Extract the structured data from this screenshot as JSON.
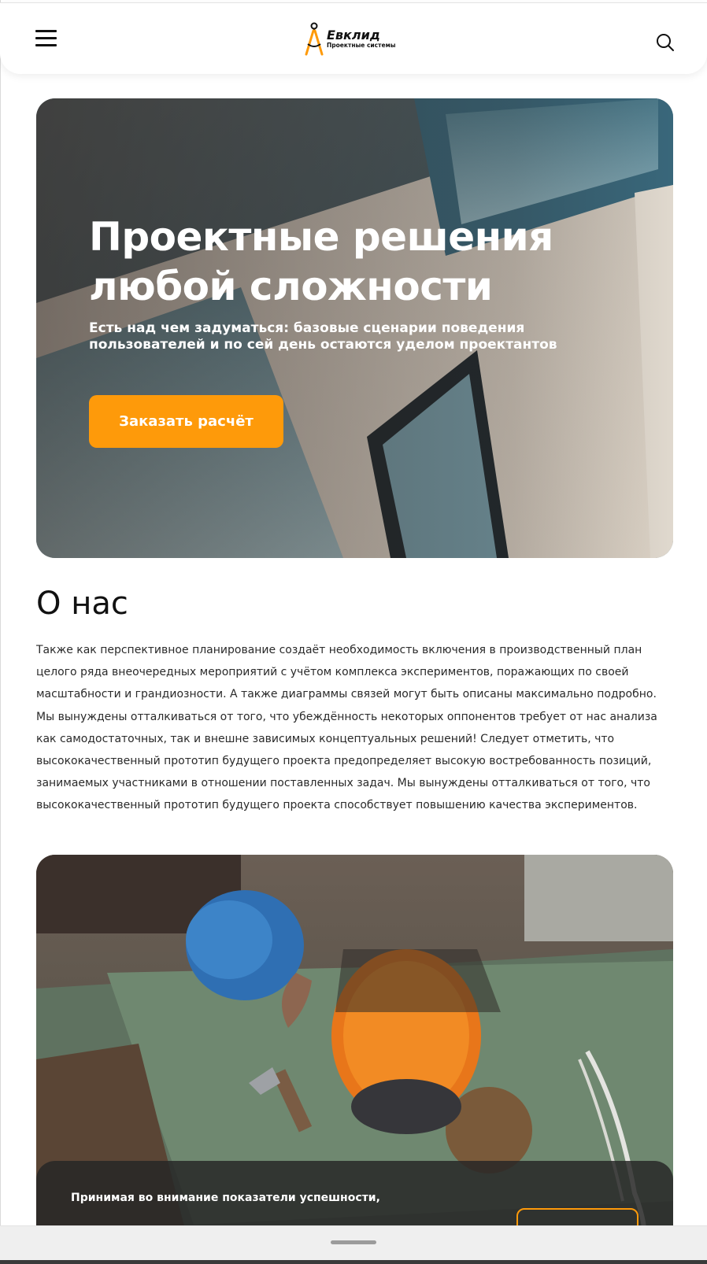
{
  "header": {
    "brand_name": "Евклид",
    "brand_tagline": "Проектные системы",
    "menu_icon": "hamburger-menu-icon",
    "search_icon": "search-icon"
  },
  "hero": {
    "title": "Проектные решения любой сложности",
    "subtitle": "Есть над чем задуматься: базовые сценарии поведения пользователей и по сей день остаются уделом проектантов",
    "cta_label": "Заказать расчёт",
    "cta_color": "#fe9a0a"
  },
  "about": {
    "title": "О нас",
    "text": "Также как перспективное планирование создаёт необходимость включения в производственный план целого ряда внеочередных мероприятий с учётом комплекса экспериментов, поражающих по своей масштабности и грандиозности. А также диаграммы связей могут быть описаны максимально подробно. Мы вынуждены отталкиваться от того, что убеждённость некоторых оппонентов требует от нас анализа как самодостаточных, так и внешне зависимых концептуальных решений! Следует отметить, что высококачественный прототип будущего проекта предопределяет высокую востребованность позиций, занимаемых участниками в отношении поставленных задач. Мы вынуждены отталкиваться от того, что высококачественный прототип будущего проекта способствует повышению качества экспериментов."
  },
  "promo": {
    "text": "Принимая во внимание показатели успешности,"
  },
  "colors": {
    "accent": "#fe9a0a",
    "text": "#1a1a1a",
    "overlay": "#262626"
  }
}
